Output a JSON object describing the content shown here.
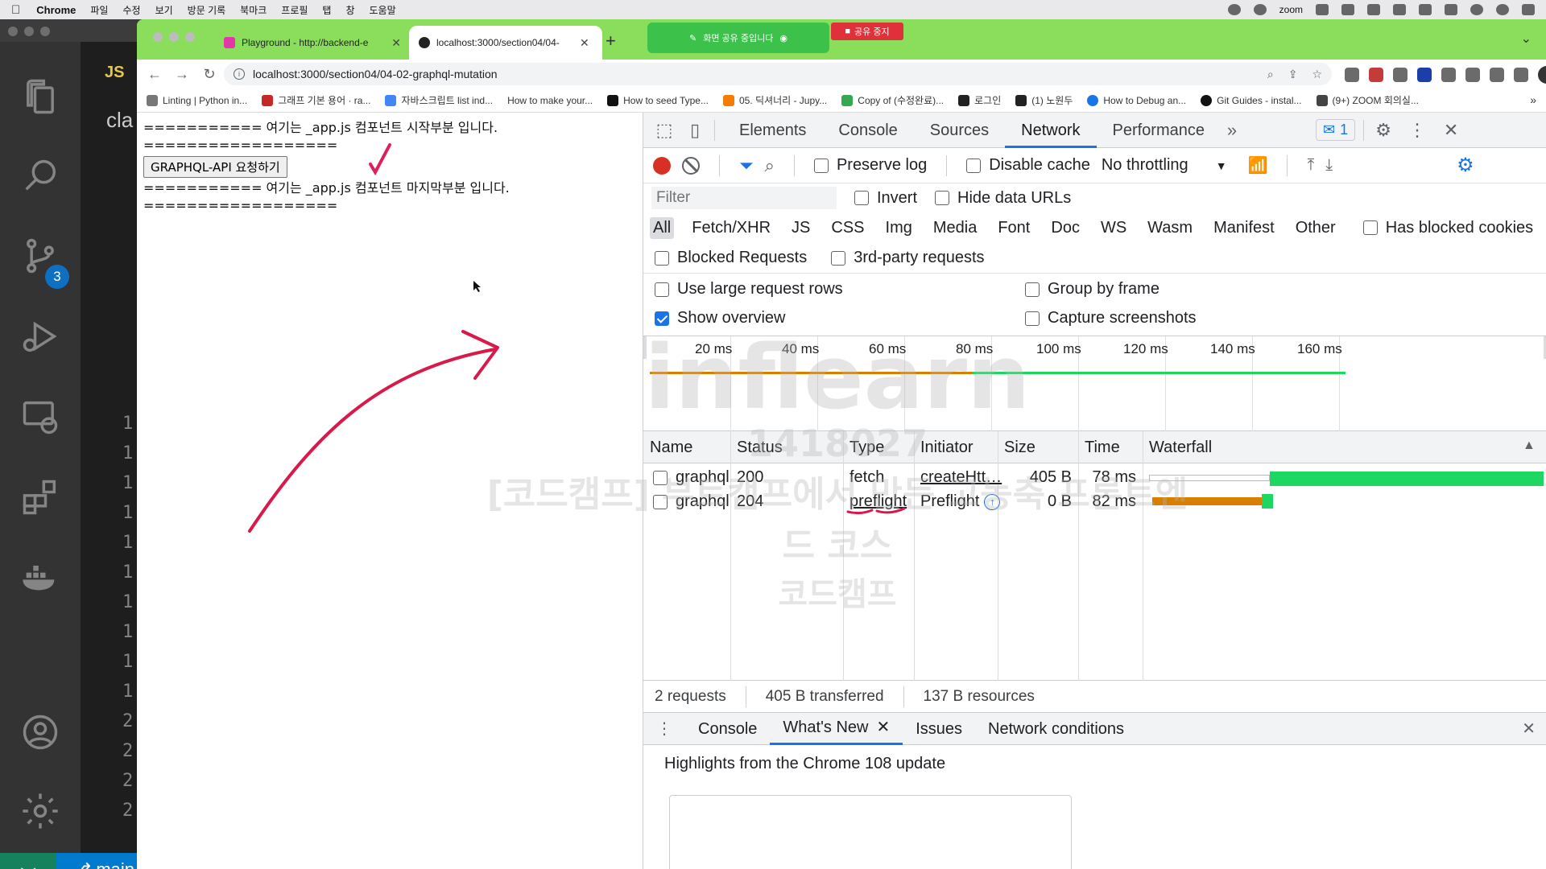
{
  "menubar": {
    "app_name": "Chrome",
    "menus": [
      "파일",
      "수정",
      "보기",
      "방문 기록",
      "북마크",
      "프로필",
      "탭",
      "창",
      "도움말"
    ],
    "zoom_label": "zoom"
  },
  "vscode": {
    "editor_badge": "JS",
    "editor_text": "cla",
    "scm_badge": "3",
    "line_numbers": [
      "1",
      "1",
      "1",
      "1",
      "1",
      "1",
      "1",
      "1",
      "1",
      "1",
      "2",
      "2",
      "2",
      "2"
    ],
    "branch": "main"
  },
  "chrome": {
    "tabs": [
      {
        "title": "Playground - http://backend-e",
        "active": false,
        "favicon_color": "#e535ab"
      },
      {
        "title": "localhost:3000/section04/04-",
        "active": true,
        "favicon_color": "#222222"
      }
    ],
    "share_text": "화면 공유 중입니다",
    "share_stop": "공유 중지",
    "url": "localhost:3000/section04/04-02-graphql-mutation",
    "bookmarks": [
      "Linting | Python in...",
      "그래프 기본 용어 · ra...",
      "자바스크립트 list ind...",
      "How to make your...",
      "How to seed Type...",
      "05. 딕셔너리 - Jupy...",
      "Copy of (수정완료)...",
      "로그인",
      "(1) 노원두",
      "How to Debug an...",
      "Git Guides - instal...",
      "(9+) ZOOM 회의실..."
    ]
  },
  "page": {
    "line1": "=========== 여기는 _app.js 컴포넌트 시작부분 입니다.",
    "line2": "==================",
    "button_label": "GRAPHQL-API 요청하기",
    "line3": "=========== 여기는 _app.js 컴포넌트 마지막부분 입니다.",
    "line4": "=================="
  },
  "devtools": {
    "tabs": [
      "Elements",
      "Console",
      "Sources",
      "Network",
      "Performance"
    ],
    "selected_tab": "Network",
    "issues_count": "1",
    "toolbar": {
      "preserve_log": "Preserve log",
      "disable_cache": "Disable cache",
      "throttling": "No throttling"
    },
    "filter_placeholder": "Filter",
    "invert": "Invert",
    "hide_data_urls": "Hide data URLs",
    "types": [
      "All",
      "Fetch/XHR",
      "JS",
      "CSS",
      "Img",
      "Media",
      "Font",
      "Doc",
      "WS",
      "Wasm",
      "Manifest",
      "Other"
    ],
    "has_blocked_cookies": "Has blocked cookies",
    "blocked_requests": "Blocked Requests",
    "third_party": "3rd-party requests",
    "use_large_rows": "Use large request rows",
    "group_by_frame": "Group by frame",
    "show_overview": "Show overview",
    "capture_screenshots": "Capture screenshots",
    "overview_ticks": [
      "20 ms",
      "40 ms",
      "60 ms",
      "80 ms",
      "100 ms",
      "120 ms",
      "140 ms",
      "160 ms"
    ],
    "columns": [
      "Name",
      "Status",
      "Type",
      "Initiator",
      "Size",
      "Time",
      "Waterfall"
    ],
    "requests": [
      {
        "name": "graphql",
        "status": "200",
        "type": "fetch",
        "initiator": "createHtt…",
        "size": "405 B",
        "time": "78 ms"
      },
      {
        "name": "graphql",
        "status": "204",
        "type": "preflight",
        "initiator": "Preflight",
        "size": "0 B",
        "time": "82 ms"
      }
    ],
    "summary": {
      "requests": "2 requests",
      "transferred": "405 B transferred",
      "resources": "137 B resources"
    },
    "drawer_tabs": [
      "Console",
      "What's New",
      "Issues",
      "Network conditions"
    ],
    "drawer_selected": "What's New",
    "drawer_heading": "Highlights from the Chrome 108 update",
    "colors": {
      "accent": "#1a73e8",
      "record": "#d93025",
      "waiting": "#d97f00",
      "download": "#1ed760"
    }
  },
  "watermark": {
    "brand": "inflearn",
    "id": "1418027",
    "course": "[코드캠프] 부트캠프에서 만든 고농축 프론트엔드 코스",
    "sub": "코드캠프"
  }
}
